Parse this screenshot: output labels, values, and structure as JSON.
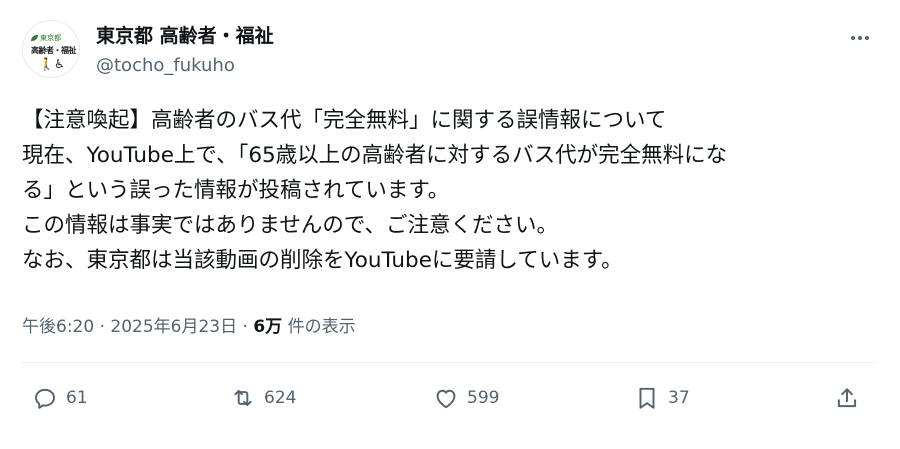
{
  "account": {
    "avatar_text_top": "東京都",
    "avatar_text_mid": "高齢者・福祉",
    "avatar_icons": "🚶♿",
    "name": "東京都 高齢者・福祉",
    "handle": "@tocho_fukuho"
  },
  "post": {
    "lines": [
      "【注意喚起】高齢者のバス代「完全無料」に関する誤情報について",
      "現在、YouTube上で、「65歳以上の高齢者に対するバス代が完全無料にな",
      "る」という誤った情報が投稿されています。",
      "この情報は事実ではありませんので、ご注意ください。",
      "なお、東京都は当該動画の削除をYouTubeに要請しています。"
    ],
    "time": "午後6:20",
    "date": "2025年6月23日",
    "views_count": "6万",
    "views_suffix": "件の表示",
    "separator": "·"
  },
  "actions": {
    "replies": "61",
    "reposts": "624",
    "likes": "599",
    "bookmarks": "37"
  },
  "icons": {
    "more": "more-icon",
    "reply": "reply-icon",
    "repost": "repost-icon",
    "like": "heart-icon",
    "bookmark": "bookmark-icon",
    "share": "share-icon"
  }
}
